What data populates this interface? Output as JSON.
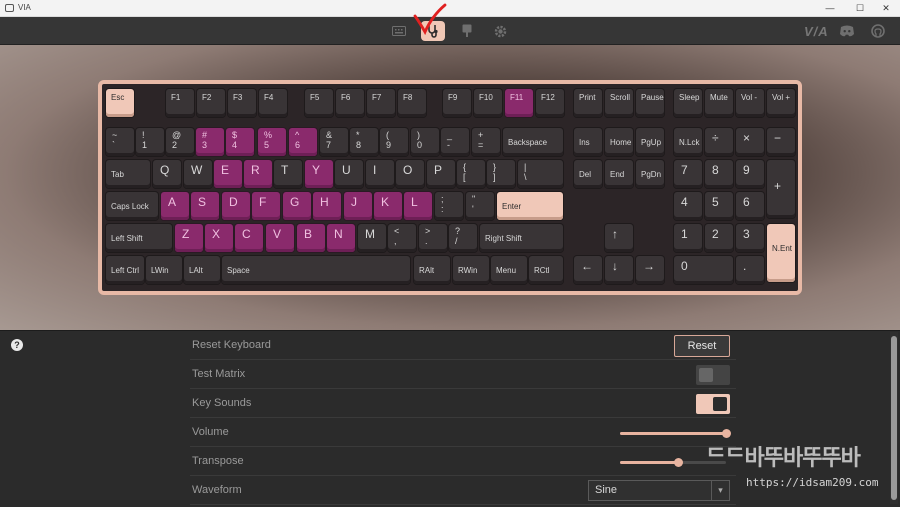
{
  "window": {
    "title": "VIA",
    "minimize": "—",
    "maximize": "☐",
    "close": "✕"
  },
  "brand": {
    "logo": "V/A"
  },
  "colors": {
    "accent": "#f0c8b8",
    "highlight_key": "#8a2a6c",
    "check_mark": "#e02020"
  },
  "keys": {
    "esc": "Esc",
    "f1": "F1",
    "f2": "F2",
    "f3": "F3",
    "f4": "F4",
    "f5": "F5",
    "f6": "F6",
    "f7": "F7",
    "f8": "F8",
    "f9": "F9",
    "f10": "F10",
    "f11": "F11",
    "f12": "F12",
    "print": "Print",
    "scroll": "Scroll",
    "pause": "Pause",
    "sleep": "Sleep",
    "mute": "Mute",
    "voldn": "Vol -",
    "volup": "Vol +",
    "grave": "~\n`",
    "n1": "!\n1",
    "n2": "@\n2",
    "n3": "#\n3",
    "n4": "$\n4",
    "n5": "%\n5",
    "n6": "^\n6",
    "n7": "&\n7",
    "n8": "*\n8",
    "n9": "(\n9",
    "n0": ")\n0",
    "minus": "_\n-",
    "equal": "+\n=",
    "backspace": "Backspace",
    "ins": "Ins",
    "home": "Home",
    "pgup": "PgUp",
    "nlck": "N.Lck",
    "div": "÷",
    "mul": "×",
    "sub": "−",
    "tab": "Tab",
    "q": "Q",
    "w": "W",
    "e": "E",
    "r": "R",
    "t": "T",
    "y": "Y",
    "u": "U",
    "i": "I",
    "o": "O",
    "p": "P",
    "lbr": "{\n[",
    "rbr": "}\n]",
    "bslash": "|\n\\",
    "del": "Del",
    "end": "End",
    "pgdn": "PgDn",
    "p7": "7",
    "p8": "8",
    "p9": "9",
    "padd": "+",
    "caps": "Caps Lock",
    "a": "A",
    "s": "S",
    "d": "D",
    "f": "F",
    "g": "G",
    "h": "H",
    "j": "J",
    "k": "K",
    "l": "L",
    "semi": ";\n:",
    "quote": "\"\n'",
    "enter": "Enter",
    "p4": "4",
    "p5": "5",
    "p6": "6",
    "lshift": "Left Shift",
    "z": "Z",
    "x": "X",
    "c": "C",
    "v": "V",
    "b": "B",
    "n": "N",
    "m": "M",
    "comma": "<\n,",
    "period": ">\n.",
    "slash": "?\n/",
    "rshift": "Right Shift",
    "up": "↑",
    "p1": "1",
    "p2": "2",
    "p3": "3",
    "pent": "N.Ent",
    "lctrl": "Left Ctrl",
    "lwin": "LWin",
    "lalt": "LAlt",
    "space": "Space",
    "ralt": "RAlt",
    "rwin": "RWin",
    "menu": "Menu",
    "rctl": "RCtl",
    "left": "←",
    "down": "↓",
    "right": "→",
    "p0": "0",
    "pdot": "."
  },
  "settings": {
    "help": "?",
    "reset_keyboard": {
      "label": "Reset Keyboard",
      "button": "Reset"
    },
    "test_matrix": {
      "label": "Test Matrix",
      "enabled": false
    },
    "key_sounds": {
      "label": "Key Sounds",
      "enabled": true
    },
    "volume": {
      "label": "Volume",
      "value": 1.0
    },
    "transpose": {
      "label": "Transpose",
      "value": 0.55
    },
    "waveform": {
      "label": "Waveform",
      "selected": "Sine"
    }
  },
  "watermark": {
    "title": "ᄃᄃ바뚜바뚜뚜바",
    "url": "https://idsam209.com"
  }
}
